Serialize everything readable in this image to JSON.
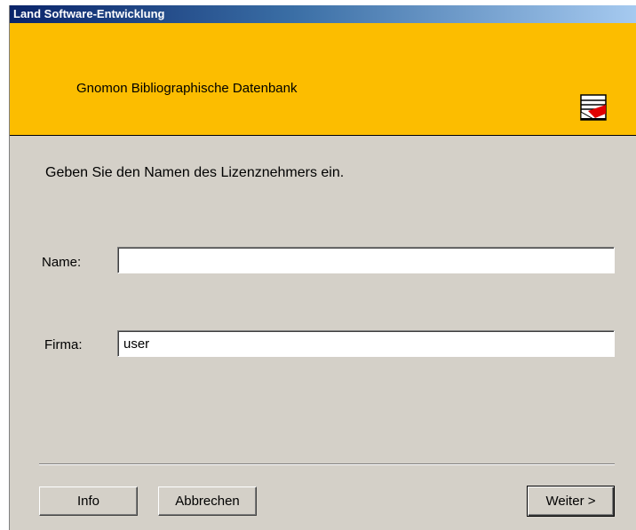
{
  "window": {
    "title": "Land Software-Entwicklung"
  },
  "banner": {
    "title": "Gnomon Bibliographische Datenbank",
    "logo_icon": "gnomon-logo-icon",
    "background_color": "#fcbd00"
  },
  "form": {
    "instruction": "Geben Sie den Namen des Lizenznehmers ein.",
    "name_label": "Name:",
    "name_value": "",
    "firma_label": "Firma:",
    "firma_value": "user"
  },
  "buttons": {
    "info_label": "Info",
    "cancel_label": "Abbrechen",
    "next_label": "Weiter >"
  }
}
